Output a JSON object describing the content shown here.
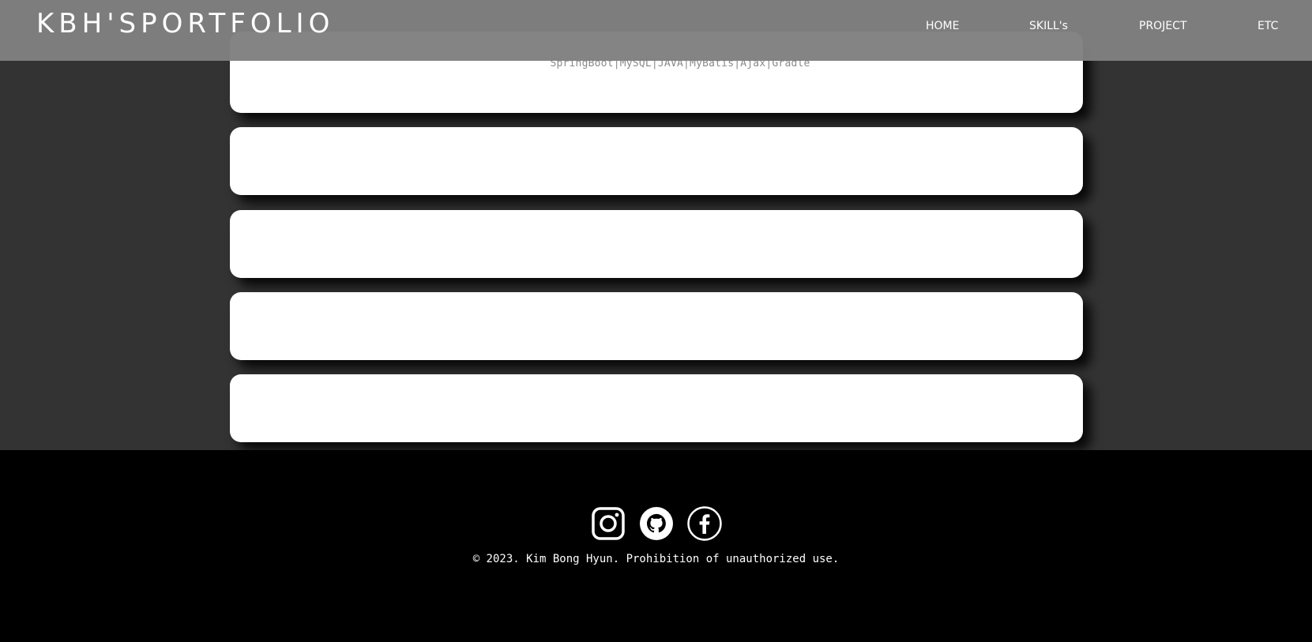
{
  "header": {
    "logo": "KBH'SPORTFOLIO",
    "nav": [
      "HOME",
      "SKILL's",
      "PROJECT",
      "ETC"
    ]
  },
  "projects": [
    {
      "tech": "SpringBoot|MySQL|JAVA|MyBatis|Ajax|Gradle"
    },
    {
      "tech": ""
    },
    {
      "tech": ""
    },
    {
      "tech": ""
    },
    {
      "tech": ""
    }
  ],
  "footer": {
    "icons": [
      "instagram-icon",
      "github-icon",
      "facebook-icon"
    ],
    "copyright": "© 2023. Kim Bong Hyun. Prohibition of unauthorized use."
  },
  "colors": {
    "header_bg": "#808080",
    "main_bg": "#333333",
    "card_bg": "#ffffff",
    "footer_bg": "#000000",
    "tech_text": "#8a8a8a"
  }
}
